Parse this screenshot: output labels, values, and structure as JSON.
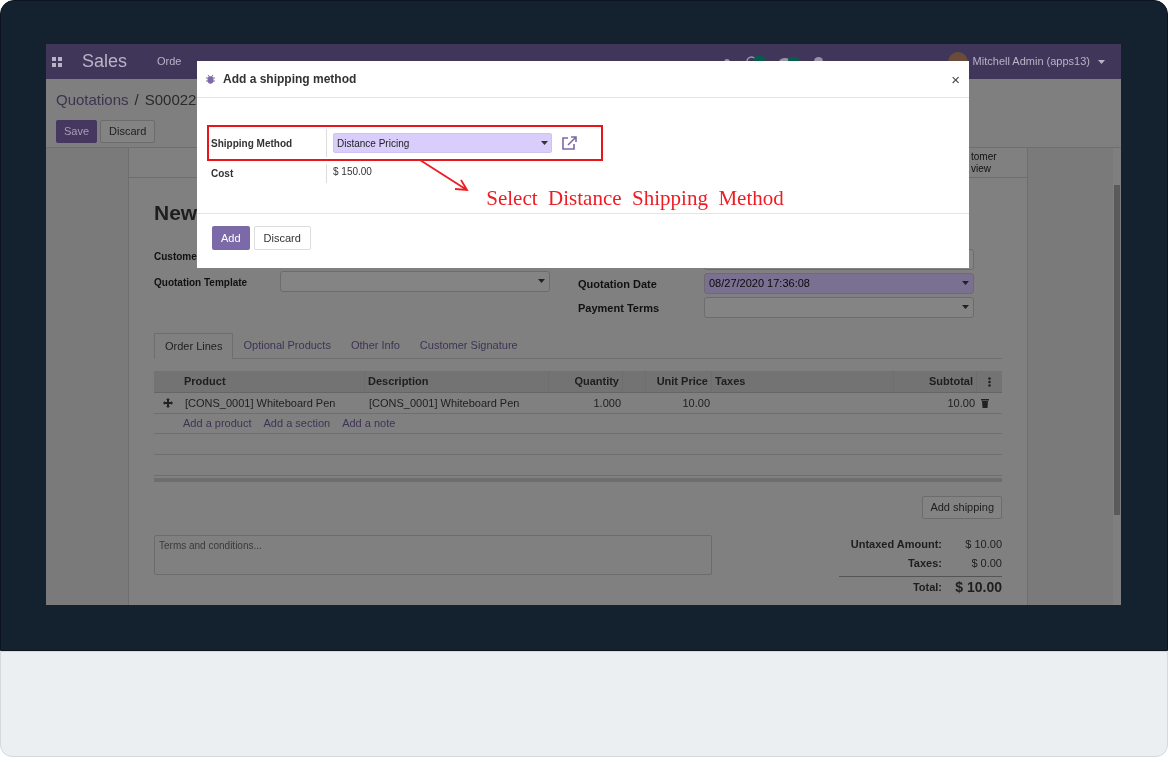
{
  "navbar": {
    "app_name": "Sales",
    "menu": [
      "Orde"
    ],
    "user": "Mitchell Admin (apps13)"
  },
  "breadcrumb": {
    "parent": "Quotations",
    "separator": "/",
    "current": "S00022"
  },
  "actions": [
    {
      "label": "Save",
      "kind": "primary"
    },
    {
      "label": "Discard",
      "kind": "secondary"
    }
  ],
  "smart_button": {
    "line1": "tomer",
    "line2": "view"
  },
  "form": {
    "title": "New",
    "left_fields": [
      {
        "label": "Custome"
      },
      {
        "label": "Quotation Template"
      }
    ],
    "right_fields": [
      {
        "label": "Quotation Date",
        "value": "08/27/2020 17:36:08",
        "required": true
      },
      {
        "label": "Payment Terms",
        "required": false
      }
    ]
  },
  "tabs": [
    {
      "label": "Order Lines",
      "selected": true
    },
    {
      "label": "Optional Products",
      "selected": false
    },
    {
      "label": "Other Info",
      "selected": false
    },
    {
      "label": "Customer Signature",
      "selected": false
    }
  ],
  "table": {
    "columns": [
      "Product",
      "Description",
      "Quantity",
      "",
      "Unit Price",
      "Taxes",
      "Subtotal"
    ],
    "rows": [
      {
        "product": "[CONS_0001] Whiteboard Pen",
        "description": "[CONS_0001] Whiteboard Pen",
        "quantity": "1.000",
        "unit_price": "10.00",
        "taxes": "",
        "subtotal": "10.00"
      }
    ],
    "add_links": [
      "Add a product",
      "Add a section",
      "Add a note"
    ]
  },
  "add_shipping": "Add shipping",
  "terms_placeholder": "Terms and conditions...",
  "totals": [
    {
      "label": "Untaxed Amount:",
      "value": "$ 10.00",
      "kind": "line"
    },
    {
      "label": "Taxes:",
      "value": "$ 0.00",
      "kind": "line"
    },
    {
      "label": "Total:",
      "value": "$ 10.00",
      "kind": "grand"
    }
  ],
  "dialog": {
    "title": "Add a shipping method",
    "close": "×",
    "fields": [
      {
        "label": "Shipping Method",
        "value": "Distance Pricing",
        "kind": "select"
      },
      {
        "label": "Cost",
        "value": "$ 150.00",
        "kind": "text"
      }
    ],
    "buttons": [
      {
        "label": "Add",
        "kind": "primary"
      },
      {
        "label": "Discard",
        "kind": "secondary"
      }
    ]
  },
  "annotation": "Select  Distance  Shipping  Method"
}
